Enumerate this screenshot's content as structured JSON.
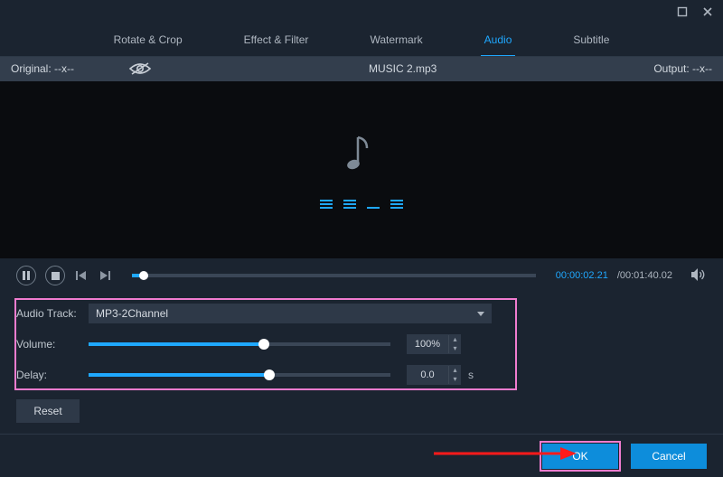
{
  "window": {
    "minimize": "–",
    "maximize": "□",
    "close": "×"
  },
  "tabs": {
    "rotate_crop": "Rotate & Crop",
    "effect_filter": "Effect & Filter",
    "watermark": "Watermark",
    "audio": "Audio",
    "subtitle": "Subtitle"
  },
  "infobar": {
    "original_label": "Original: --x--",
    "filename": "MUSIC 2.mp3",
    "output_label": "Output: --x--"
  },
  "playback": {
    "current_time": "00:00:02.21",
    "duration": "/00:01:40.02",
    "seek_percent": 3
  },
  "settings": {
    "audio_track_label": "Audio Track:",
    "audio_track_value": "MP3-2Channel",
    "volume_label": "Volume:",
    "volume_value": "100%",
    "volume_percent": 58,
    "delay_label": "Delay:",
    "delay_value": "0.0",
    "delay_unit": "s",
    "delay_percent": 60,
    "reset": "Reset"
  },
  "footer": {
    "ok": "OK",
    "cancel": "Cancel"
  }
}
